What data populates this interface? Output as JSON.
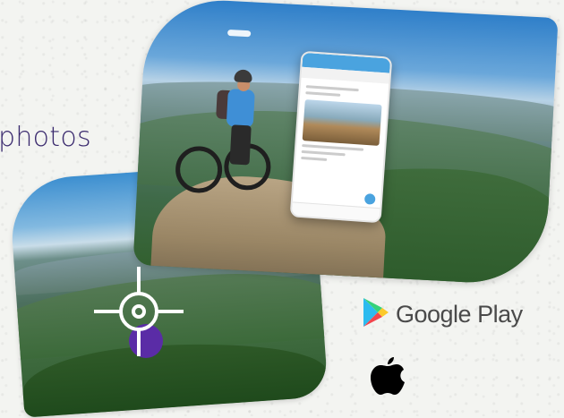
{
  "headline": {
    "text": "photos"
  },
  "stores": {
    "google": {
      "label": "Google Play",
      "icon": "google-play-icon"
    },
    "apple": {
      "icon": "apple-icon"
    }
  },
  "map_marker": {
    "icon": "crosshair-icon",
    "color": "#5a2ca6"
  },
  "colors": {
    "headline": "#3a2a6e",
    "accent_purple": "#5a2ca6",
    "background": "#f3f4f1"
  }
}
